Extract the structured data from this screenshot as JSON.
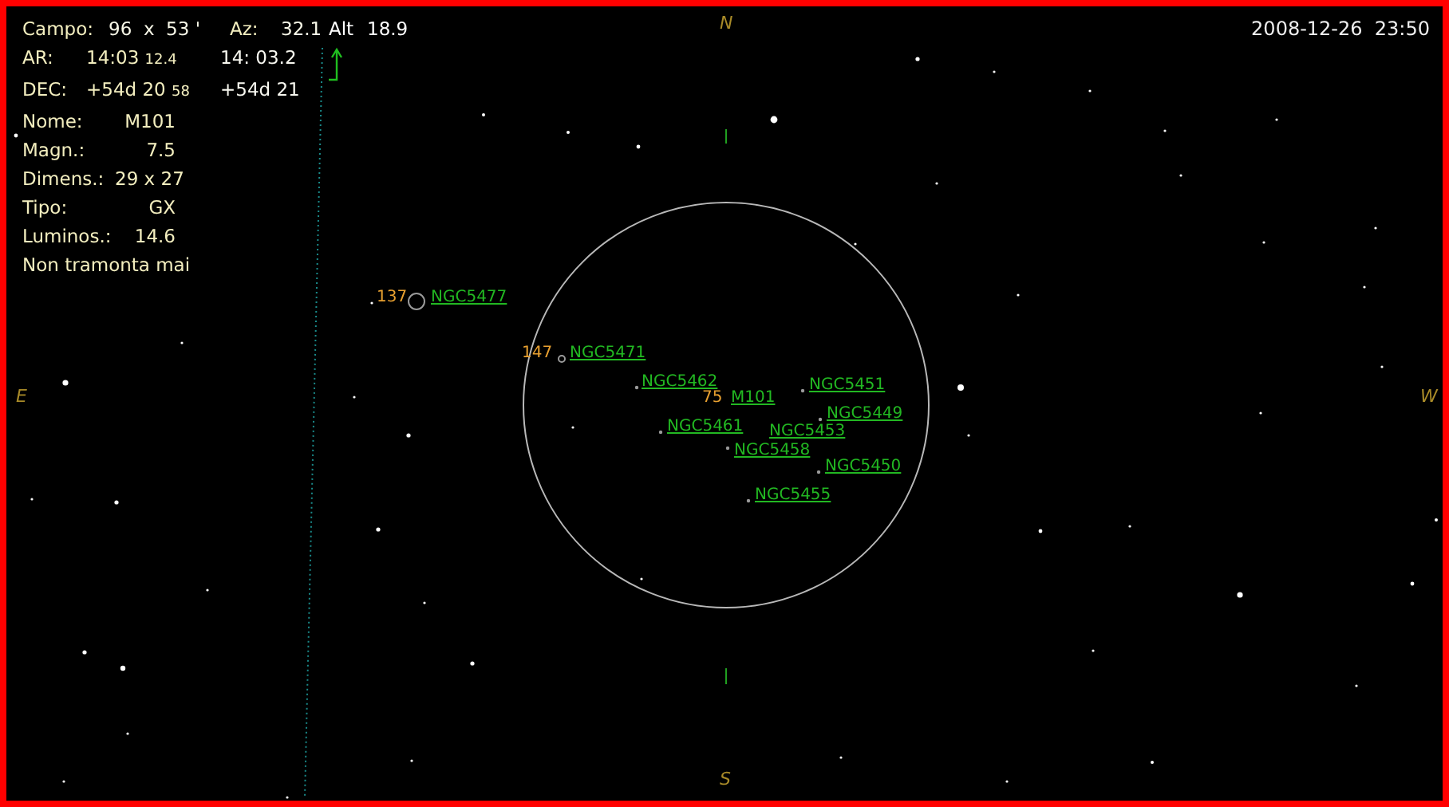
{
  "header": {
    "fov_label": "Campo:",
    "fov_value": "96  x  53 '",
    "az_label": "Az:",
    "az_value": "32.1",
    "alt_label": "Alt",
    "alt_value": "18.9"
  },
  "coords": [
    {
      "label": "AR:",
      "value": "14:03",
      "value_small": "12.4",
      "alt_value": "14: 03.2"
    },
    {
      "label": "DEC:",
      "value": "+54d 20",
      "value_small": "58",
      "alt_value": "+54d 21"
    }
  ],
  "details": [
    {
      "label": "Nome:",
      "value": "M101"
    },
    {
      "label": "Magn.:",
      "value": "7.5"
    },
    {
      "label": "Dimens.:",
      "value": "29 x 27"
    },
    {
      "label": "Tipo:",
      "value": "GX"
    },
    {
      "label": "Luminos.:",
      "value": "14.6"
    }
  ],
  "note": "Non tramonta mai",
  "datetime": "2008-12-26  23:50",
  "compass": {
    "north": "N",
    "east": "E",
    "west": "W",
    "south": "S"
  },
  "objects": [
    {
      "name": "NGC5477",
      "magnitude": "137"
    },
    {
      "name": "NGC5471",
      "magnitude": "147"
    },
    {
      "name": "NGC5462"
    },
    {
      "name": "M101",
      "magnitude": "75"
    },
    {
      "name": "NGC5451"
    },
    {
      "name": "NGC5449"
    },
    {
      "name": "NGC5461"
    },
    {
      "name": "NGC5453"
    },
    {
      "name": "NGC5458"
    },
    {
      "name": "NGC5450"
    },
    {
      "name": "NGC5455"
    }
  ]
}
